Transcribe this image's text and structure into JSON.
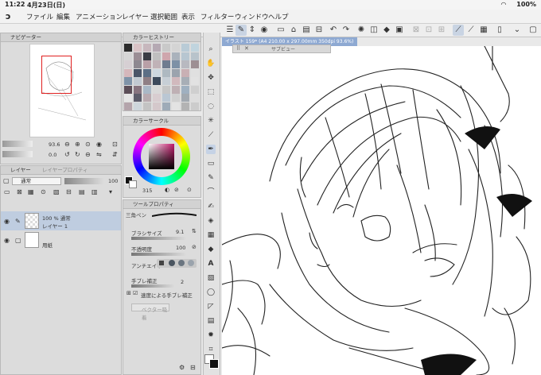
{
  "status": {
    "time": "11:22",
    "date": "4月23日(日)",
    "battery": "100%"
  },
  "menu": [
    "ファイル",
    "編集",
    "アニメーション",
    "レイヤー",
    "選択範囲",
    "表示",
    "フィルター",
    "ウィンドウ",
    "ヘルプ"
  ],
  "document_tab": "イラスト 159* (A4 210.00 x 297.00mm 350dpi 93.6%)",
  "subview_label": "サブビュー",
  "navigator": {
    "title": "ナビゲーター",
    "zoom": "93.6",
    "rotation": "0.0"
  },
  "color_history": {
    "title": "カラーヒストリー",
    "colors": [
      "#2b2b2b",
      "#d9c3c6",
      "#c7b7bd",
      "#b5a9b3",
      "#c9c9c9",
      "#d4d4d4",
      "#b9cbd6",
      "#c0d4de",
      "#d6d6d6",
      "#9b8e95",
      "#3a3d45",
      "#bfbfbf",
      "#cfa6ad",
      "#aab2bc",
      "#b7c6d1",
      "#b8c3cb",
      "#d6cfd3",
      "#8d8890",
      "#b9a0a7",
      "#c0b2b7",
      "#6f7c8f",
      "#7d91a6",
      "#b8b9c0",
      "#9d8f93",
      "#d5b7bb",
      "#4a5568",
      "#5c6f85",
      "#cdd7df",
      "#aeb9c1",
      "#9ba3ad",
      "#c9b0b4",
      "#e0e0e0",
      "#7f93a8",
      "#c2cad2",
      "#8f7f85",
      "#3d4a5c",
      "#c7cfd6",
      "#d1b9bd",
      "#a7aeb6",
      "#e2e2e2",
      "#5c4e58",
      "#87747f",
      "#a9b8c6",
      "#d9d9d9",
      "#c6c6c6",
      "#bfb0b4",
      "#9fb0c0",
      "#cfcfcf",
      "#e5e5e5",
      "#5c5c6a",
      "#b8aab0",
      "#d8cdd0",
      "#bac7d3",
      "#d0d0d0",
      "#a2a9b0",
      "#dddddd",
      "#b4a4ab",
      "#ced6dc",
      "#c3c3c3",
      "#d4c8cb",
      "#9eabb8",
      "#e3e3e3",
      "#b3b3b3",
      "#cccccc"
    ]
  },
  "color_circle": {
    "title": "カラーサークル",
    "value": "315",
    "selected": "#c24d8f"
  },
  "layer": {
    "title": "レイヤー",
    "tab2": "レイヤープロパティ",
    "blend": "通常",
    "opacity": "100",
    "rows": [
      {
        "line1": "100 % 通常",
        "line2": "レイヤー 1"
      },
      {
        "line1": "",
        "line2": "用紙"
      }
    ]
  },
  "tool_property": {
    "title": "ツールプロパティ",
    "brush_name": "三角ペン",
    "brush_size_label": "ブラシサイズ",
    "brush_size_value": "9.1",
    "opacity_label": "不透明度",
    "opacity_value": "100",
    "antialias_label": "アンチエイリ",
    "stabilization_label": "手ブレ補正",
    "stabilization_value": "2",
    "speed_stab_label": "速度による手ブレ補正",
    "vector_label": "ベクター吸着"
  },
  "colors": {
    "accent": "#8ea9d2",
    "panel": "#dcdcdc",
    "red_frame": "#e02020"
  }
}
